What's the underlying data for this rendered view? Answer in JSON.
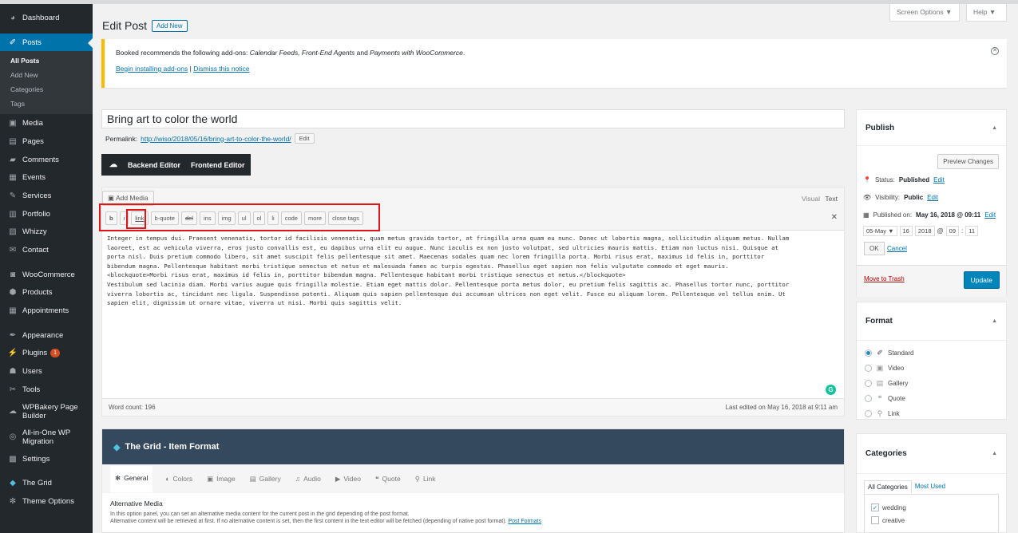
{
  "sidebar": {
    "items": [
      {
        "label": "Dashboard",
        "icon": "dashboard-icon"
      },
      {
        "label": "Posts",
        "icon": "pin-icon"
      },
      {
        "label": "Media",
        "icon": "media-icon"
      },
      {
        "label": "Pages",
        "icon": "pages-icon"
      },
      {
        "label": "Comments",
        "icon": "comments-icon"
      },
      {
        "label": "Events",
        "icon": "calendar-icon"
      },
      {
        "label": "Services",
        "icon": "services-icon"
      },
      {
        "label": "Portfolio",
        "icon": "portfolio-icon"
      },
      {
        "label": "Whizzy",
        "icon": "whizzy-icon"
      },
      {
        "label": "Contact",
        "icon": "mail-icon"
      },
      {
        "label": "WooCommerce",
        "icon": "woo-icon"
      },
      {
        "label": "Products",
        "icon": "products-icon"
      },
      {
        "label": "Appointments",
        "icon": "calendar-icon"
      },
      {
        "label": "Appearance",
        "icon": "brush-icon"
      },
      {
        "label": "Plugins",
        "icon": "plugin-icon",
        "badge": "1"
      },
      {
        "label": "Users",
        "icon": "user-icon"
      },
      {
        "label": "Tools",
        "icon": "wrench-icon"
      },
      {
        "label": "WPBakery Page Builder",
        "icon": "wpbakery-icon"
      },
      {
        "label": "All-in-One WP Migration",
        "icon": "migration-icon"
      },
      {
        "label": "Settings",
        "icon": "settings-icon"
      },
      {
        "label": "The Grid",
        "icon": "grid-icon"
      },
      {
        "label": "Theme Options",
        "icon": "gear-icon"
      }
    ],
    "posts_submenu": [
      "All Posts",
      "Add New",
      "Categories",
      "Tags"
    ]
  },
  "header": {
    "title": "Edit Post",
    "add_new": "Add New",
    "screen_options": "Screen Options ▼",
    "help": "Help ▼"
  },
  "notice": {
    "text_before": "Booked recommends the following add-ons: ",
    "text_em": "Calendar Feeds, Front-End Agents",
    "text_mid": " and ",
    "text_em2": "Payments with WooCommerce",
    "text_after": ".",
    "link_install": "Begin installing add-ons",
    "separator": " | ",
    "link_dismiss": "Dismiss this notice"
  },
  "post": {
    "title": "Bring art to color the world",
    "permalink_label": "Permalink:",
    "permalink_url": "http://wiso/2018/05/16/bring-art-to-color-the-world/",
    "edit_label": "Edit"
  },
  "vc": {
    "backend": "Backend Editor",
    "frontend": "Frontend Editor"
  },
  "editor": {
    "add_media": "Add Media",
    "tab_visual": "Visual",
    "tab_text": "Text",
    "buttons": [
      "b",
      "i",
      "link",
      "b-quote",
      "del",
      "ins",
      "img",
      "ul",
      "ol",
      "li",
      "code",
      "more",
      "close tags"
    ],
    "content": "Integer in tempus dui. Praesent venenatis, tortor id facilisis venenatis, quam metus gravida tortor, at fringilla urna quam eu nunc. Donec ut lobortis magna, sollicitudin aliquam metus. Nullam\nlaoreet, est ac vehicula viverra, eros justo convallis est, eu dapibus urna elit eu augue. Nunc iaculis ex non justo volutpat, sed ultricies mauris mattis. Etiam non luctus nisi. Quisque at\nporta nisl. Duis pretium commodo libero, sit amet suscipit felis pellentesque sit amet. Maecenas sodales quam nec lorem fringilla porta. Morbi risus erat, maximus id felis in, porttitor\nbibendum magna. Pellentesque habitant morbi tristique senectus et netus et malesuada fames ac turpis egestas. Phasellus eget sapien non felis vulputate commodo et eget mauris.\n<blockquote>Morbi risus erat, maximus id felis in, porttitor bibendum magna. Pellentesque habitant morbi tristique senectus et netus.</blockquote>\nVestibulum sed lacinia diam. Morbi varius augue quis fringilla molestie. Etiam eget mattis dolor. Pellentesque porta metus dolor, eu pretium felis sagittis ac. Phasellus tortor nunc, porttitor\nviverra lobortis ac, tincidunt nec ligula. Suspendisse potenti. Aliquam quis sapien pellentesque dui accumsan ultrices non eget velit. Fusce eu aliquam lorem. Pellentesque vel tellus enim. Ut\nsapien elit, dignissim ut ornare vitae, viverra ut nisi. Morbi quis sagittis velit.",
    "word_count": "Word count: 196",
    "last_edited": "Last edited on May 16, 2018 at 9:11 am"
  },
  "grid": {
    "title": "The Grid - Item Format",
    "tabs": [
      "General",
      "Colors",
      "Image",
      "Gallery",
      "Audio",
      "Video",
      "Quote",
      "Link"
    ],
    "section_title": "Alternative Media",
    "desc1": "In this option panel, you can set an alternative media content for the current post in the grid depending of the post format.",
    "desc2": "Alternative content will be retrieved at first. If no alternative content is set, then the first content in the text editor will be fetched (depending of native post format). ",
    "desc_link": "Post Formats"
  },
  "publish": {
    "title": "Publish",
    "preview": "Preview Changes",
    "status_label": "Status:",
    "status_value": "Published",
    "visibility_label": "Visibility:",
    "visibility_value": "Public",
    "published_on_label": "Published on:",
    "published_on_value": "May 16, 2018 @ 09:11",
    "edit": "Edit",
    "month": "05-May ▼",
    "day": "16",
    "year": "2018",
    "at": "@",
    "hour": "09",
    "colon": ":",
    "minute": "11",
    "ok": "OK",
    "cancel": "Cancel",
    "trash": "Move to Trash",
    "update": "Update"
  },
  "format": {
    "title": "Format",
    "options": [
      {
        "label": "Standard",
        "icon": "pin-icon",
        "selected": true
      },
      {
        "label": "Video",
        "icon": "video-icon",
        "selected": false
      },
      {
        "label": "Gallery",
        "icon": "gallery-icon",
        "selected": false
      },
      {
        "label": "Quote",
        "icon": "quote-icon",
        "selected": false
      },
      {
        "label": "Link",
        "icon": "link-icon",
        "selected": false
      }
    ]
  },
  "categories": {
    "title": "Categories",
    "tab_all": "All Categories",
    "tab_used": "Most Used",
    "items": [
      {
        "label": "wedding",
        "checked": true
      },
      {
        "label": "creative",
        "checked": false
      }
    ]
  },
  "colors": {
    "accent": "#0073aa",
    "sidebar": "#23282d",
    "highlight": "#e2141a",
    "grid_header": "#34495e"
  }
}
